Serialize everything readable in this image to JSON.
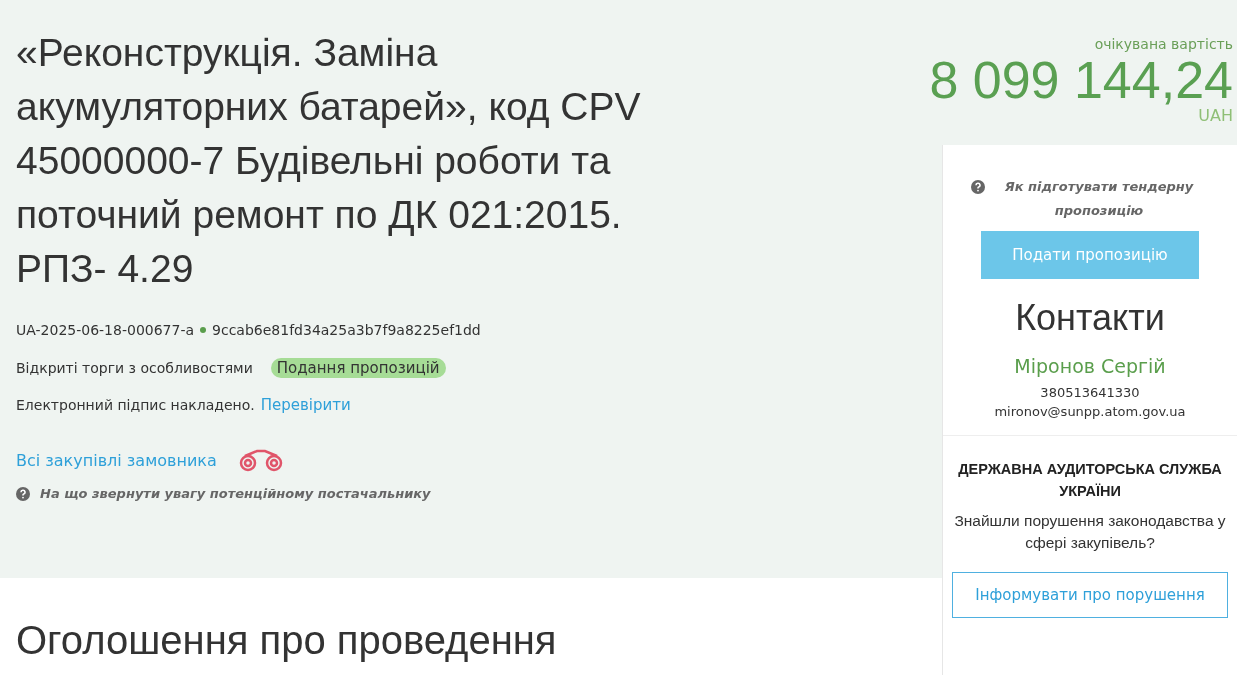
{
  "tender": {
    "title": "«Реконструкція. Заміна акумуляторних батарей», код CPV 45000000-7 Будівельні роботи та поточний ремонт по ДК 021:2015. РПЗ- 4.29",
    "id": "UA-2025-06-18-000677-a",
    "hash": "9ccab6e81fd34a25a3b7f9a8225ef1dd",
    "procedure": "Відкриті торги з особливостями",
    "status": "Подання пропозицій",
    "signature": "Електронний підпис накладено.",
    "verify_link": "Перевірити",
    "buyer_link": "Всі закупівлі замовника",
    "hint": "На що звернути увагу потенційному постачальнику"
  },
  "price": {
    "label": "очікувана вартість",
    "amount": "8 099 144,24",
    "currency": "UAH"
  },
  "sidebar": {
    "hint": "Як підготувати тендерну пропозицію",
    "submit_button": "Подати пропозицію",
    "contacts": {
      "heading": "Контакти",
      "name": "Міронов Сергій",
      "phone": "380513641330",
      "email": "mironov@sunpp.atom.gov.ua"
    },
    "audit": {
      "heading": "ДЕРЖАВНА АУДИТОРСЬКА СЛУЖБА УКРАЇНИ",
      "question": "Знайшли порушення законодавства у сфері закупівель?",
      "button": "Інформувати про порушення"
    }
  },
  "section_heading": "Оголошення про проведення"
}
